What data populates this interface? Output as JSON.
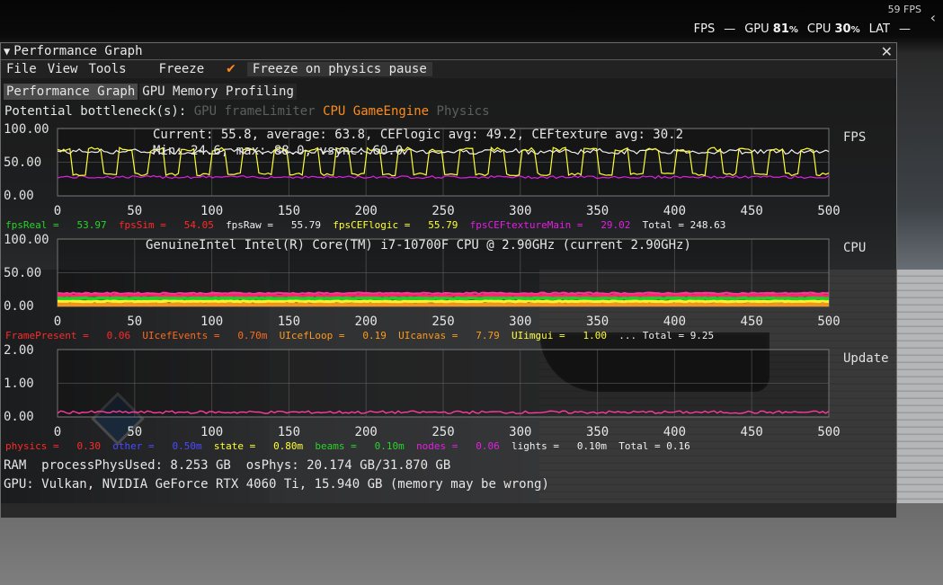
{
  "overlay": {
    "fps_small": "59 FPS",
    "chevron": "‹",
    "fps_label": "FPS",
    "dash1": "—",
    "gpu_label": "GPU",
    "gpu_value": "81",
    "percent": "%",
    "cpu_label": "CPU",
    "cpu_value": "30",
    "lat_label": "LAT",
    "dash2": "—"
  },
  "window": {
    "title": "Performance Graph",
    "collapse_glyph": "▼",
    "close_glyph": "✕"
  },
  "menu": {
    "file": "File",
    "view": "View",
    "tools": "Tools",
    "freeze": "Freeze",
    "freeze_physics": "Freeze on physics pause",
    "check": "✔"
  },
  "tabs": [
    {
      "label": "Performance Graph"
    },
    {
      "label": "GPU Memory Profiling"
    }
  ],
  "bottleneck": {
    "label": "Potential bottleneck(s):",
    "items": [
      "GPU",
      "frameLimiter",
      "CPU",
      "GameEngine",
      "Physics"
    ]
  },
  "colors": {
    "yellow": "#ffff33",
    "white": "#f0f0f0",
    "magenta": "#e020e0",
    "green": "#2cd12c",
    "red": "#ff2a2a",
    "orange": "#ff9a1a",
    "blue": "#4a4aff",
    "pink": "#ff3aa0",
    "grid": "#6a6a6a"
  },
  "graphs": {
    "fps": {
      "name": "FPS",
      "info1": "Current: 55.8, average: 63.8, CEFlogic avg: 49.2, CEFtexture avg: 30.2",
      "info2": "Min: 24.6, max: 88.0, vsync: 60.0",
      "y_ticks": [
        "100.00",
        "50.00",
        "0.00"
      ],
      "legend": [
        {
          "label": "fpsReal =",
          "value": "53.97",
          "color": "#2cd12c"
        },
        {
          "label": "fpsSim =",
          "value": "54.05",
          "color": "#ff2a2a"
        },
        {
          "label": "fpsRaw =",
          "value": "55.79",
          "color": "#f0f0f0"
        },
        {
          "label": "fpsCEFlogic =",
          "value": "55.79",
          "color": "#ffff33"
        },
        {
          "label": "fpsCEFtextureMain =",
          "value": "29.02",
          "color": "#e020e0"
        },
        {
          "label": "Total = 248.63",
          "value": "",
          "color": "#f0f0f0"
        }
      ]
    },
    "cpu": {
      "name": "CPU",
      "info1": "GenuineIntel Intel(R) Core(TM) i7-10700F CPU @ 2.90GHz (current 2.90GHz)",
      "y_ticks": [
        "100.00",
        "50.00",
        "0.00"
      ],
      "legend": [
        {
          "label": "FramePresent =",
          "value": "0.06",
          "color": "#ff2a2a"
        },
        {
          "label": "UIcefEvents =",
          "value": "0.70m",
          "color": "#ff6a1a"
        },
        {
          "label": "UIcefLoop =",
          "value": "0.19",
          "color": "#ff9a1a"
        },
        {
          "label": "UIcanvas =",
          "value": "7.79",
          "color": "#ff9a1a"
        },
        {
          "label": "UIimgui =",
          "value": "1.00",
          "color": "#ffff33"
        },
        {
          "label": "... Total = 9.25",
          "value": "",
          "color": "#f0f0f0"
        }
      ]
    },
    "update": {
      "name": "Update",
      "y_ticks": [
        "2.00",
        "1.00",
        "0.00"
      ],
      "legend": [
        {
          "label": "physics =",
          "value": "0.30",
          "color": "#ff2a2a"
        },
        {
          "label": "other =",
          "value": "0.50m",
          "color": "#4a4aff"
        },
        {
          "label": "state =",
          "value": "0.80m",
          "color": "#ffff33"
        },
        {
          "label": "beams =",
          "value": "0.10m",
          "color": "#2cd12c"
        },
        {
          "label": "nodes =",
          "value": "0.06",
          "color": "#e020e0"
        },
        {
          "label": "lights =",
          "value": "0.10m",
          "color": "#f0f0f0"
        },
        {
          "label": "Total = 0.16",
          "value": "",
          "color": "#f0f0f0"
        }
      ]
    },
    "x_ticks": [
      "0",
      "50",
      "100",
      "150",
      "200",
      "250",
      "300",
      "350",
      "400",
      "450",
      "500"
    ]
  },
  "system": {
    "ram": "RAM  processPhysUsed: 8.253 GB  osPhys: 20.174 GB/31.870 GB",
    "gpu": "GPU: Vulkan, NVIDIA GeForce RTX 4060 Ti, 15.940 GB (memory may be wrong)"
  }
}
